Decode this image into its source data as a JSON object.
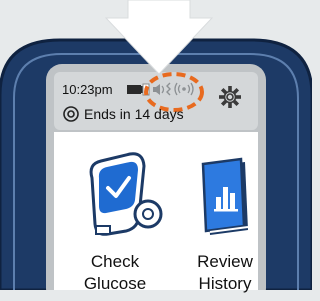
{
  "status_bar": {
    "time": "10:23pm",
    "battery_icon": "battery-icon",
    "sound_icon": "speaker-icon",
    "vibrate_icon": "vibrate-icon",
    "wireless_icon": "wireless-icon"
  },
  "sensor": {
    "icon": "sensor-icon",
    "text": "Ends in 14 days"
  },
  "settings_icon": "gear-icon",
  "tiles": {
    "check_glucose": {
      "line1": "Check",
      "line2": "Glucose",
      "icon": "glucose-meter-icon"
    },
    "review_history": {
      "line1": "Review",
      "line2": "History",
      "icon": "history-book-icon"
    }
  },
  "annotation": {
    "arrow_color": "#ffffff",
    "circle_color": "#e86a1f"
  },
  "colors": {
    "device_body": "#1d3a66",
    "screen_bezel": "#bfc3c6",
    "screen": "#ffffff",
    "accent_blue": "#1f6bd1"
  }
}
